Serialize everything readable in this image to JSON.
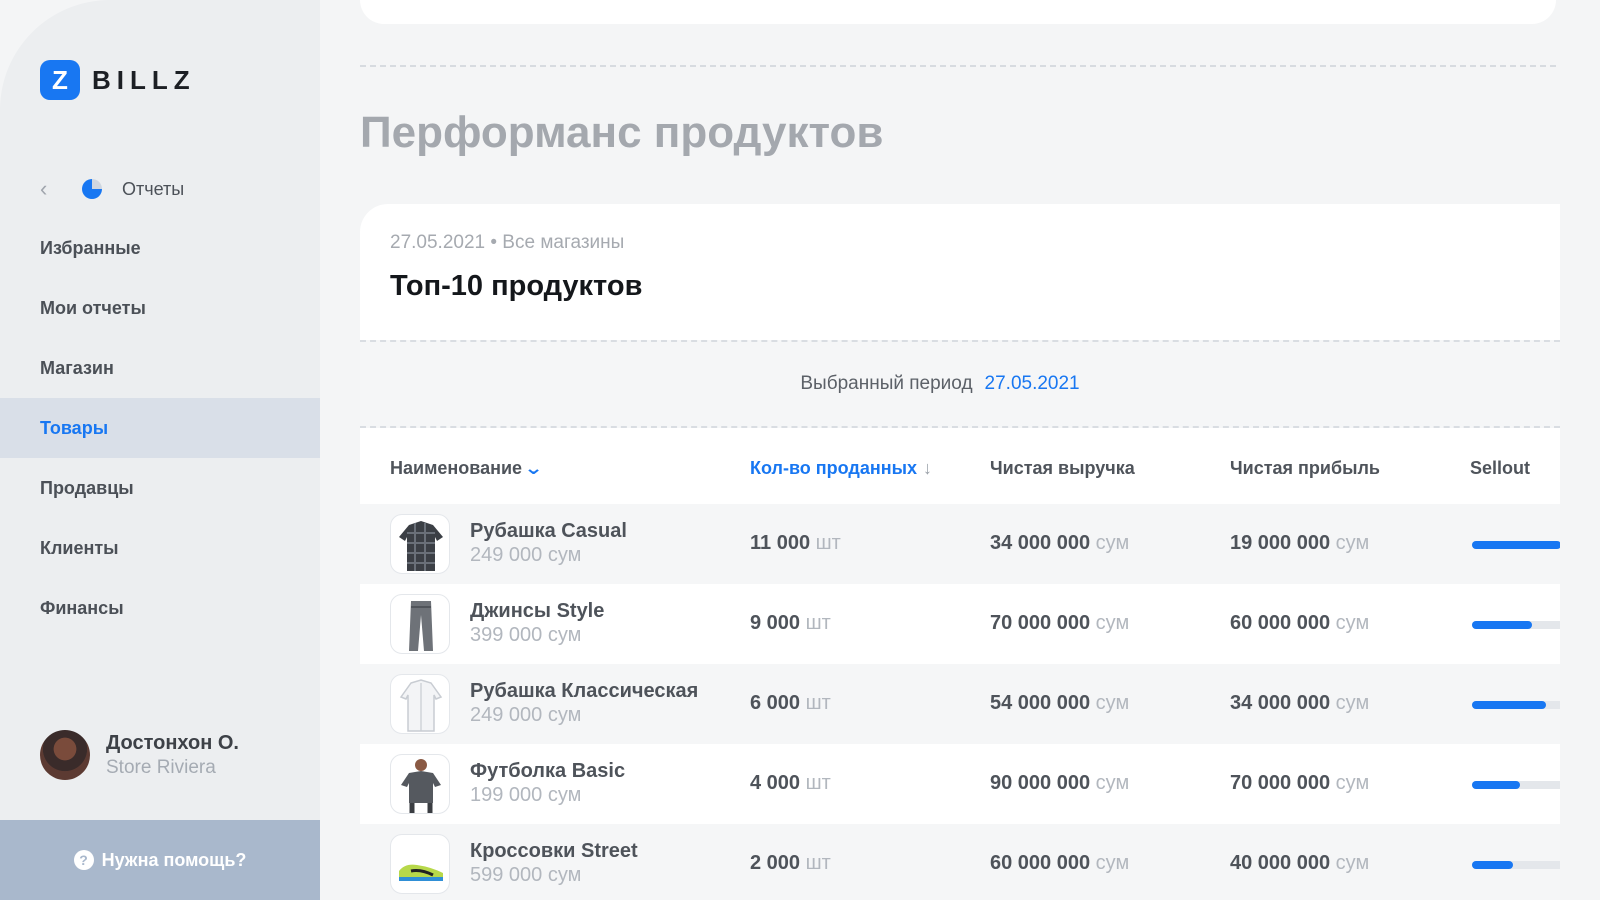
{
  "brand": {
    "mark": "Z",
    "name": "BILLZ"
  },
  "sidebar": {
    "back_label": "Отчеты",
    "items": [
      {
        "label": "Избранные",
        "active": false
      },
      {
        "label": "Мои отчеты",
        "active": false
      },
      {
        "label": "Магазин",
        "active": false
      },
      {
        "label": "Товары",
        "active": true
      },
      {
        "label": "Продавцы",
        "active": false
      },
      {
        "label": "Клиенты",
        "active": false
      },
      {
        "label": "Финансы",
        "active": false
      }
    ],
    "user": {
      "name": "Достонхон О.",
      "store": "Store Riviera"
    },
    "help": {
      "icon": "?",
      "label": "Нужна помощь?"
    }
  },
  "page_title": "Перформанс продуктов",
  "card": {
    "subtitle": "27.05.2021 • Все магазины",
    "title": "Топ-10 продуктов",
    "period_label": "Выбранный период",
    "period_date": "27.05.2021"
  },
  "table": {
    "headers": {
      "name": "Наименование",
      "qty": "Кол-во проданных",
      "revenue": "Чистая выручка",
      "profit": "Чистая прибыль",
      "sellout": "Sellout"
    },
    "units": {
      "qty": "шт",
      "money": "сум"
    },
    "rows": [
      {
        "name": "Рубашка Casual",
        "price": "249 000 сум",
        "qty": "11 000",
        "revenue": "34 000 000",
        "profit": "19 000 000",
        "sellout": 0.97,
        "icon": "plaid-shirt"
      },
      {
        "name": "Джинсы Style",
        "price": "399 000 сум",
        "qty": "9 000",
        "revenue": "70 000 000",
        "profit": "60 000 000",
        "sellout": 0.65,
        "icon": "jeans"
      },
      {
        "name": "Рубашка Классическая",
        "price": "249 000 сум",
        "qty": "6 000",
        "revenue": "54 000 000",
        "profit": "34 000 000",
        "sellout": 0.8,
        "icon": "white-shirt"
      },
      {
        "name": "Футболка Basic",
        "price": "199 000 сум",
        "qty": "4 000",
        "revenue": "90 000 000",
        "profit": "70 000 000",
        "sellout": 0.52,
        "icon": "t-shirt"
      },
      {
        "name": "Кроссовки Street",
        "price": "599 000 сум",
        "qty": "2 000",
        "revenue": "60 000 000",
        "profit": "40 000 000",
        "sellout": 0.45,
        "icon": "sneakers"
      }
    ]
  },
  "colors": {
    "accent": "#1877f2",
    "sidebar_bg": "#eceef0",
    "active_bg": "#d9dfe8",
    "help_bg": "#a9b8cc"
  }
}
